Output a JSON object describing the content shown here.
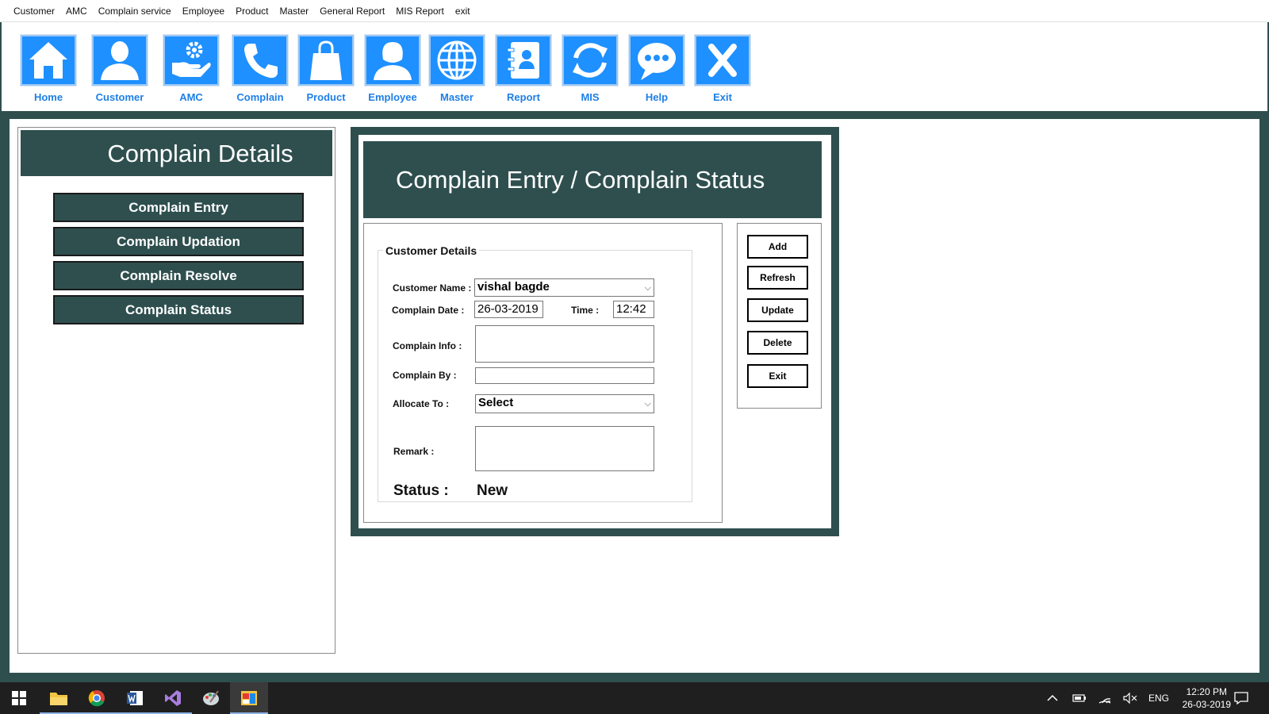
{
  "menu": [
    "Customer",
    "AMC",
    "Complain service",
    "Employee",
    "Product",
    "Master",
    "General Report",
    "MIS Report",
    "exit"
  ],
  "toolbar": [
    {
      "label": "Home",
      "icon": "home-icon"
    },
    {
      "label": "Customer",
      "icon": "person-icon"
    },
    {
      "label": "AMC",
      "icon": "gear-hand-icon"
    },
    {
      "label": "Complain",
      "icon": "phone-icon"
    },
    {
      "label": "Product",
      "icon": "shopping-bag-icon"
    },
    {
      "label": "Employee",
      "icon": "woman-icon"
    },
    {
      "label": "Master",
      "icon": "globe-icon"
    },
    {
      "label": "Report",
      "icon": "contact-book-icon"
    },
    {
      "label": "MIS",
      "icon": "refresh-icon"
    },
    {
      "label": "Help",
      "icon": "chat-bubble-icon"
    },
    {
      "label": "Exit",
      "icon": "close-icon"
    }
  ],
  "left_panel": {
    "title": "Complain Details",
    "buttons": [
      "Complain Entry",
      "Complain Updation",
      "Complain Resolve",
      "Complain Status"
    ]
  },
  "main": {
    "title": "Complain Entry / Complain Status",
    "group_title": "Customer Details",
    "labels": {
      "customer_name": "Customer Name :",
      "complain_date": "Complain Date :",
      "time": "Time :",
      "complain_info": "Complain Info :",
      "complain_by": "Complain By :",
      "allocate_to": "Allocate To :",
      "remark": "Remark :",
      "status": "Status :"
    },
    "values": {
      "customer_name": "vishal  bagde",
      "complain_date": "26-03-2019",
      "time": "12:42",
      "complain_info": "",
      "complain_by": "",
      "allocate_to": "Select",
      "remark": "",
      "status": "New"
    },
    "actions": [
      "Add",
      "Refresh",
      "Update",
      "Delete",
      "Exit"
    ]
  },
  "taskbar": {
    "language": "ENG",
    "time": "12:20 PM",
    "date": "26-03-2019"
  },
  "colors": {
    "theme": "#2f4f4f",
    "tile": "#1e90ff",
    "tile_label": "#1e7fe6"
  }
}
